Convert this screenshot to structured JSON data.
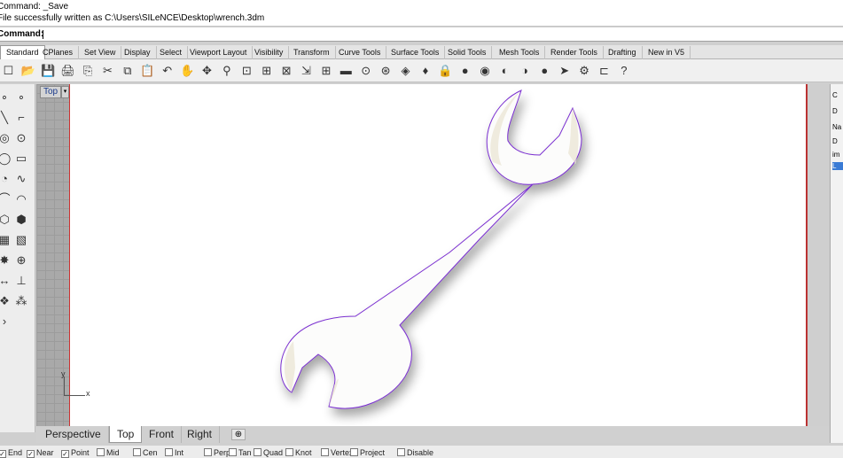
{
  "command_history": {
    "line1": "Command: _Save",
    "line2": "File successfully written as C:\\Users\\SILeNCE\\Desktop\\wrench.3dm"
  },
  "command_prompt": {
    "label": "Command:",
    "value": ""
  },
  "toolbar_tabs": [
    "Standard",
    "CPlanes",
    "Set View",
    "Display",
    "Select",
    "Viewport Layout",
    "Visibility",
    "Transform",
    "Curve Tools",
    "Surface Tools",
    "Solid Tools",
    "Mesh Tools",
    "Render Tools",
    "Drafting",
    "New in V5"
  ],
  "toolbar_icons": [
    "new-icon",
    "open-icon",
    "save-icon",
    "print-icon",
    "import-icon",
    "cut-icon",
    "copy-icon",
    "paste-icon",
    "undo-icon",
    "pan-icon",
    "rotate-view-icon",
    "zoom-icon",
    "zoom-window-icon",
    "zoom-extents-icon",
    "zoom-selected-icon",
    "set-view-icon",
    "four-viewports-icon",
    "car-icon",
    "osnap-icon",
    "gumball-icon",
    "layer-icon",
    "light-icon",
    "lock-icon",
    "material-icon",
    "color-wheel-icon",
    "sphere-icon",
    "rendered-sphere-icon",
    "render-icon",
    "cursor-icon",
    "gear-icon",
    "scale-icon",
    "help-icon"
  ],
  "toolbar_glyphs": [
    "☐",
    "📂",
    "💾",
    "🖨",
    "⎘",
    "✂",
    "⧉",
    "📋",
    "↶",
    "✋",
    "✥",
    "⚲",
    "⊡",
    "⊞",
    "⊠",
    "⇲",
    "⊞",
    "▬",
    "⊙",
    "⊛",
    "◈",
    "♦",
    "🔒",
    "●",
    "◉",
    "◐",
    "◑",
    "●",
    "➤",
    "⚙",
    "⊏",
    "?"
  ],
  "left_tools": [
    "point-icon",
    "polyline-icon",
    "arc-icon",
    "circle-icon",
    "ellipse-icon",
    "rectangle-icon",
    "curve-icon",
    "freeform-icon",
    "surface-icon",
    "extrude-icon",
    "box-icon",
    "sphere-icon",
    "mesh-icon",
    "boolean-icon",
    "transform-icon",
    "move-icon",
    "rotate-icon",
    "dimension-icon",
    "array-icon",
    "block-icon",
    "analyze-icon",
    "render-icon",
    "more-icon"
  ],
  "left_glyphs": [
    "∘",
    "∘",
    "╲",
    "⌐",
    "◎",
    "⊙",
    "◯",
    "▭",
    "◔",
    "∿",
    "⌒",
    "◠",
    "⬡",
    "⬢",
    "▦",
    "▧",
    "✸",
    "⊕",
    "↔",
    "⊥",
    "❖",
    "⁂",
    "›"
  ],
  "viewport": {
    "label": "Top",
    "menu_glyph": "▾",
    "axis_x": "x",
    "axis_y": "y"
  },
  "right_panel": {
    "items": [
      "C",
      "D",
      "Na",
      "D",
      "im",
      "L"
    ]
  },
  "view_tabs": [
    "Perspective",
    "Top",
    "Front",
    "Right"
  ],
  "view_tab_active": "Top",
  "view_add": "⊕",
  "osnaps": [
    {
      "label": "End",
      "checked": true
    },
    {
      "label": "Near",
      "checked": true
    },
    {
      "label": "Point",
      "checked": true
    },
    {
      "label": "Mid",
      "checked": false
    },
    {
      "label": "Cen",
      "checked": false
    },
    {
      "label": "Int",
      "checked": false
    },
    {
      "label": "Perp",
      "checked": false
    },
    {
      "label": "Tan",
      "checked": false
    },
    {
      "label": "Quad",
      "checked": false
    },
    {
      "label": "Knot",
      "checked": false
    },
    {
      "label": "Vertex",
      "checked": false
    },
    {
      "label": "Project",
      "checked": false
    },
    {
      "label": "Disable",
      "checked": false
    }
  ],
  "colors": {
    "wrench_outline": "#7a2fd0",
    "viewport_bg": "#ffffff",
    "grid_margin": "#a9a9a9"
  }
}
